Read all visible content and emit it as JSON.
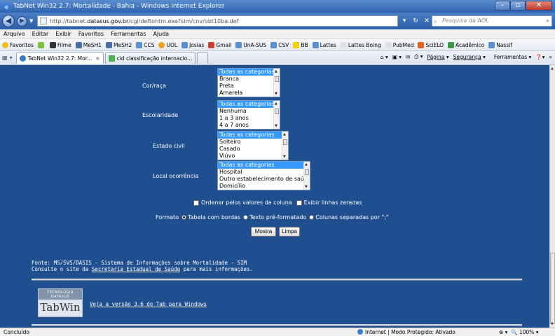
{
  "window": {
    "title": "TabNet Win32 2.7: Mortalidade - Bahia - Windows Internet Explorer"
  },
  "address": {
    "url_prefix": "http://tabnet.",
    "url_domain": "datasus.gov.br",
    "url_suffix": "/cgi/deftohtm.exe?sim/cnv/obt10ba.def",
    "search_placeholder": "Pesquisa da AOL"
  },
  "menu": [
    "Arquivo",
    "Editar",
    "Exibir",
    "Favoritos",
    "Ferramentas",
    "Ajuda"
  ],
  "favorites": {
    "label": "Favoritos",
    "items": [
      "Filme",
      "MeSH1",
      "MeSH2",
      "CCS",
      "UOL",
      "Josias",
      "Gmail",
      "UnA-SUS",
      "CSV",
      "BB",
      "Lattes",
      "Lattes Boing",
      "PubMed",
      "SciELO",
      "Acadêmico",
      "Nassif"
    ]
  },
  "tabs": [
    {
      "label": "TabNet Win32 2.7: Mor...",
      "close": "×"
    },
    {
      "label": "cid classificação internacio..."
    }
  ],
  "commandbar": {
    "pagina": "Página",
    "seguranca": "Segurança",
    "ferramentas": "Ferramentas"
  },
  "form": {
    "fields": [
      {
        "label": "Cor/raça",
        "options": [
          "Todas as categorias",
          "Branca",
          "Preta",
          "Amarela"
        ]
      },
      {
        "label": "Escolaridade",
        "options": [
          "Todas as categorias",
          "Nenhuma",
          "1 a 3 anos",
          "4 a 7 anos"
        ]
      },
      {
        "label": "Estado civil",
        "options": [
          "Todas as categorias",
          "Solteiro",
          "Casado",
          "Viúvo"
        ]
      },
      {
        "label": "Local ocorrência",
        "options": [
          "Todas as categorias",
          "Hospital",
          "Outro estabelecimento de saúde",
          "Domicílio"
        ]
      }
    ],
    "order_label": "Ordenar pelos valores da coluna",
    "zero_label": "Exibir linhas zeradas",
    "format_label": "Formato",
    "format_options": [
      "Tabela com bordas",
      "Texto pré-formatado",
      "Colunas separadas por \";\""
    ],
    "submit_label": "Mostra",
    "reset_label": "Limpa"
  },
  "footer": {
    "source": "Fonte: MS/SVS/DASIS - Sistema de Informações sobre Mortalidade - SIM",
    "consult_prefix": "Consulte o site da ",
    "consult_link": "Secretaria Estadual de Saúde",
    "consult_suffix": " para mais informações.",
    "logo_top": "TECNOLOGIA\nDATASUS",
    "logo_name": "TabWin",
    "tab_link": "Veja a versão 3.6 do Tab para Windows"
  },
  "status": {
    "left": "Concluído",
    "zone": "Internet | Modo Protegido: Ativado",
    "zoom": "100%"
  }
}
